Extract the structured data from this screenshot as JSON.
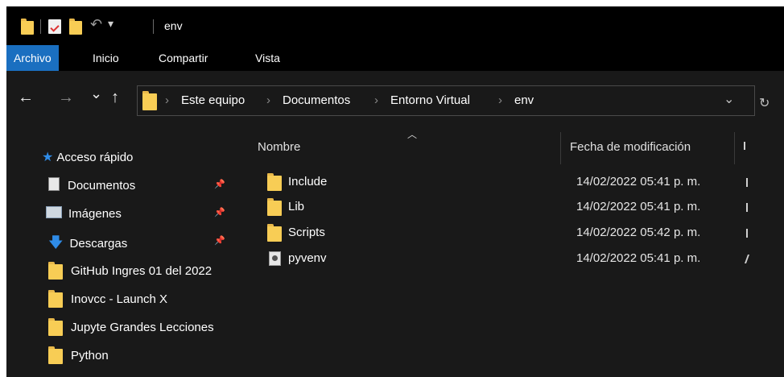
{
  "titlebar": {
    "title": "env",
    "qa_dropdown": "▾"
  },
  "ribbon": {
    "tabs": [
      {
        "label": "Archivo",
        "active": true
      },
      {
        "label": "Inicio"
      },
      {
        "label": "Compartir"
      },
      {
        "label": "Vista"
      }
    ]
  },
  "nav": {
    "back": "←",
    "forward": "→",
    "recent": "⌄",
    "up": "↑"
  },
  "address": {
    "separator": "›",
    "crumbs": [
      "Este equipo",
      "Documentos",
      "Entorno Virtual",
      "env"
    ],
    "dropdown": "⌄",
    "refresh": "↻"
  },
  "navpane": {
    "quick_access": "Acceso rápido",
    "items": [
      {
        "label": "Documentos",
        "icon": "documents-icon",
        "pinned": true
      },
      {
        "label": "Imágenes",
        "icon": "pictures-icon",
        "pinned": true
      },
      {
        "label": "Descargas",
        "icon": "download-icon",
        "pinned": true
      },
      {
        "label": "GitHub Ingres 01 del 2022",
        "icon": "folder-icon"
      },
      {
        "label": "Inovcc - Launch X",
        "icon": "folder-icon"
      },
      {
        "label": "Jupyte Grandes Lecciones",
        "icon": "folder-icon"
      },
      {
        "label": "Python",
        "icon": "folder-icon"
      }
    ],
    "pin_glyph": "📌"
  },
  "content": {
    "columns": {
      "name": "Nombre",
      "date": "Fecha de modificación"
    },
    "files": [
      {
        "name": "Include",
        "date": "14/02/2022 05:41 p. m.",
        "type": "folder"
      },
      {
        "name": "Lib",
        "date": "14/02/2022 05:41 p. m.",
        "type": "folder"
      },
      {
        "name": "Scripts",
        "date": "14/02/2022 05:42 p. m.",
        "type": "folder"
      },
      {
        "name": "pyvenv",
        "date": "14/02/2022 05:41 p. m.",
        "type": "file"
      }
    ]
  },
  "colors": {
    "accent": "#1a6fc0",
    "folder": "#f8cd55",
    "star": "#2f8ce8"
  }
}
